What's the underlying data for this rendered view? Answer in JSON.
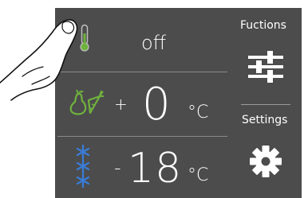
{
  "panel": {
    "background": "#4c4c4c",
    "accent_green": "#6fb23e",
    "accent_blue": "#3a7bd5"
  },
  "top_row": {
    "status": "off",
    "icon": "thermometer-icon"
  },
  "fridge_row": {
    "sign": "+",
    "temperature": "0",
    "unit": "°C",
    "icon": "fruit-vegetable-icon"
  },
  "freezer_row": {
    "sign": "-",
    "temperature": "18",
    "unit": "°C",
    "icon": "snowflake-icon"
  },
  "sidebar": {
    "functions_label": "Fuctions",
    "functions_icon": "sliders-icon",
    "settings_label": "Settings",
    "settings_icon": "gear-icon"
  }
}
